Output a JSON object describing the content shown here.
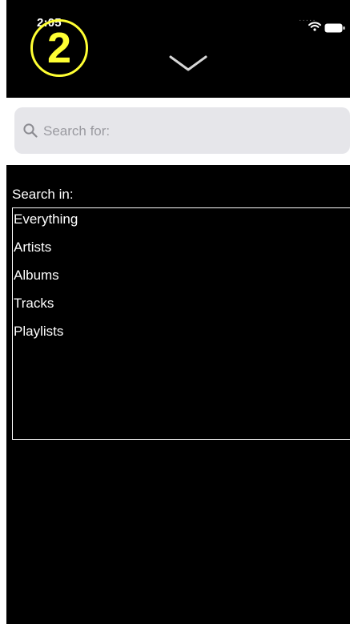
{
  "status_bar": {
    "time": "2:05",
    "badge": "2",
    "signal": "·····",
    "wifi_icon": "wifi-icon",
    "battery_icon": "battery-icon"
  },
  "header": {
    "dismiss_icon": "chevron-down-icon"
  },
  "search": {
    "placeholder": "Search for:",
    "value": "",
    "icon": "magnifier-icon"
  },
  "scope": {
    "label": "Search in:",
    "options": [
      "Everything",
      "Artists",
      "Albums",
      "Tracks",
      "Playlists"
    ]
  },
  "colors": {
    "background": "#000000",
    "badge": "#ffff33",
    "search_field": "#e6e6ea",
    "placeholder": "#9a9aa0"
  }
}
